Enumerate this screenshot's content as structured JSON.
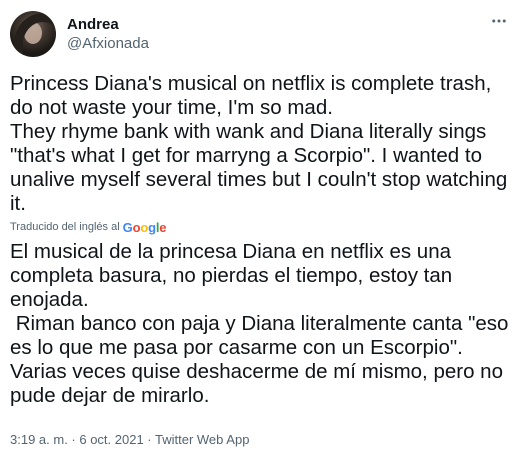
{
  "author": {
    "display_name": "Andrea",
    "handle": "@Afxionada"
  },
  "tweet": {
    "text": "Princess Diana's musical on netflix is complete trash,\ndo not waste your time, I'm so mad.\nThey rhyme bank with wank and Diana literally sings\n\"that's what I get for marryng a Scorpio\". I wanted to\nunalive myself several times but I couln't stop watching\nit.",
    "translated_label": "Traducido del inglés al",
    "translation_provider": "Google",
    "translation": "El musical de la princesa Diana en netflix es una\ncompleta basura, no pierdas el tiempo, estoy tan\nenojada.\n Riman banco con paja y Diana literalmente canta \"eso\nes lo que me pasa por casarme con un Escorpio\".\nVarias veces quise deshacerme de mí mismo, pero no\npude dejar de mirarlo."
  },
  "meta": {
    "timestamp": "3:19 a. m. · 6 oct. 2021 · Twitter Web App"
  },
  "icons": {
    "more": "more-options-icon"
  }
}
